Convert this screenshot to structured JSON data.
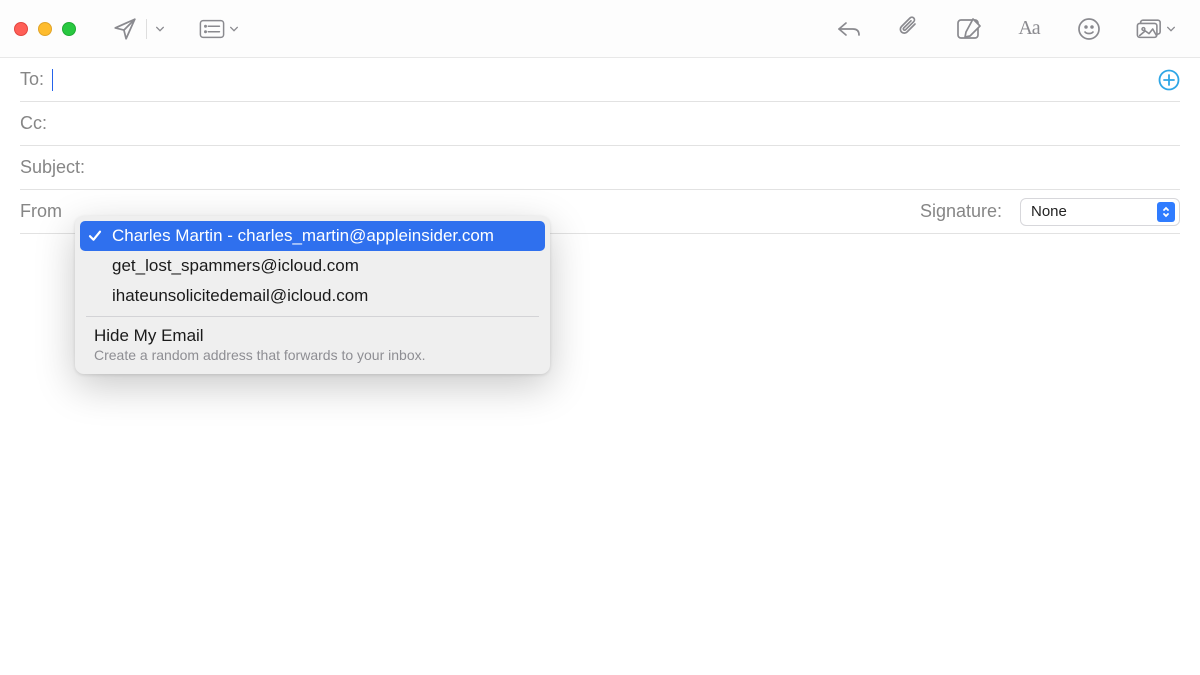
{
  "fields": {
    "to_label": "To:",
    "cc_label": "Cc:",
    "subject_label": "Subject:",
    "from_label": "From"
  },
  "signature": {
    "label": "Signature:",
    "selected": "None"
  },
  "from_dropdown": {
    "options": [
      "Charles Martin - charles_martin@appleinsider.com",
      "get_lost_spammers@icloud.com",
      "ihateunsolicitedemail@icloud.com"
    ],
    "selected_index": 0,
    "hide_my_email": {
      "title": "Hide My Email",
      "subtitle": "Create a random address that forwards to your inbox."
    }
  },
  "colors": {
    "accent_blue": "#2f70ee",
    "add_blue": "#2ea6e6"
  }
}
